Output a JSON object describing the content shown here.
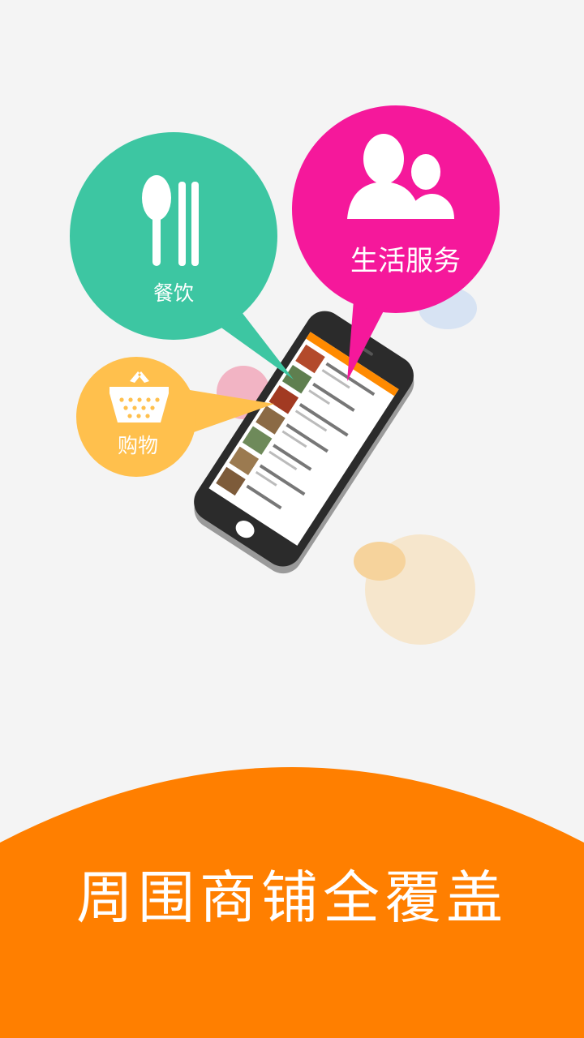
{
  "categories": {
    "dining": {
      "label": "餐饮",
      "icon": "spoon-chopsticks-icon",
      "color": "#3dc6a2"
    },
    "life_service": {
      "label": "生活服务",
      "icon": "people-icon",
      "color": "#f5189b"
    },
    "shopping": {
      "label": "购物",
      "icon": "basket-icon",
      "color": "#ffc04d"
    }
  },
  "tagline": "周围商铺全覆盖",
  "colors": {
    "background": "#f4f4f4",
    "accent": "#ff7f00",
    "phone_body": "#2b2b2b"
  }
}
